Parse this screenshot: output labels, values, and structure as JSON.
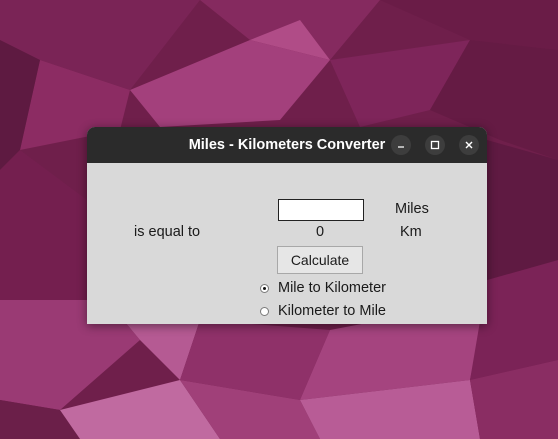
{
  "window": {
    "title": "Miles - Kilometers Converter",
    "minimize_icon": "minimize-icon",
    "maximize_icon": "maximize-icon",
    "close_icon": "close-icon"
  },
  "form": {
    "input_value": "",
    "miles_label": "Miles",
    "equal_label": "is equal to",
    "result_value": "0",
    "km_label": "Km",
    "calculate_label": "Calculate"
  },
  "modes": [
    {
      "label": "Mile to Kilometer",
      "selected": true
    },
    {
      "label": "Kilometer to Mile",
      "selected": false
    }
  ],
  "colors": {
    "titlebar": "#2b2b2b",
    "window_bg": "#d9d9d9",
    "desktop_accent": "#77216f"
  }
}
